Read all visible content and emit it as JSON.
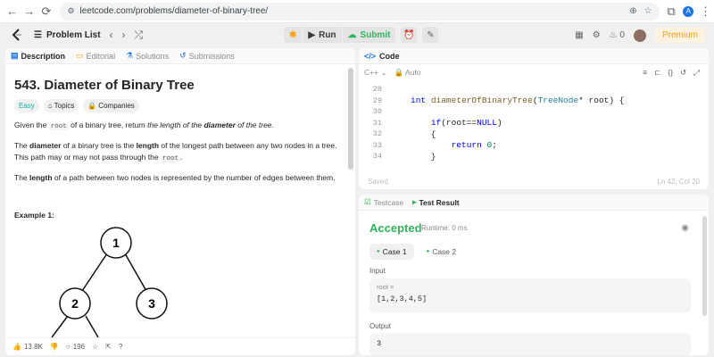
{
  "browser": {
    "url": "leetcode.com/problems/diameter-of-binary-tree/",
    "profile_initial": "A"
  },
  "appbar": {
    "problem_list": "Problem List",
    "run": "Run",
    "submit": "Submit",
    "notifications": "0",
    "premium": "Premium"
  },
  "left": {
    "tabs": [
      "Description",
      "Editorial",
      "Solutions",
      "Submissions"
    ],
    "title": "543. Diameter of Binary Tree",
    "chips": [
      "Easy",
      "Topics",
      "Companies"
    ],
    "p1": {
      "a": "Given the ",
      "b": "root",
      "c": " of a binary tree, return ",
      "d": "the length of the ",
      "e": "diameter",
      "f": " of the tree."
    },
    "p2": {
      "a": "The ",
      "b": "diameter",
      "c": " of a binary tree is the ",
      "d": "length",
      "e": " of the longest path between any two nodes in a tree. This path may or may not pass through the ",
      "f": "root",
      "g": "."
    },
    "p3": {
      "a": "The ",
      "b": "length",
      "c": " of a path between two nodes is represented by the number of edges between them."
    },
    "example": "Example 1:",
    "tree_nodes": [
      "1",
      "2",
      "3"
    ],
    "likes": "13.8K",
    "comments": "196"
  },
  "code": {
    "header": "Code",
    "language": "C++",
    "mode": "Auto",
    "saved": "Saved",
    "position": "Ln 42, Col 20",
    "lines": [
      {
        "n": "28",
        "text": ""
      },
      {
        "n": "29",
        "text": "int diameterOfBinaryTree(TreeNode* root) {"
      },
      {
        "n": "30",
        "text": ""
      },
      {
        "n": "31",
        "text": "    if(root==NULL)"
      },
      {
        "n": "32",
        "text": "    {"
      },
      {
        "n": "33",
        "text": "        return 0;"
      },
      {
        "n": "34",
        "text": "    }"
      }
    ]
  },
  "result": {
    "tabs": [
      "Testcase",
      "Test Result"
    ],
    "status": "Accepted",
    "runtime": "Runtime: 0 ms",
    "cases": [
      "Case 1",
      "Case 2"
    ],
    "input_label": "Input",
    "input_var": "root =",
    "input_value": "[1,2,3,4,5]",
    "output_label": "Output",
    "output_value": "3"
  },
  "colors": {
    "accent_green": "#2db55d",
    "premium_orange": "#ffa116",
    "easy_teal": "#00b8a3"
  }
}
